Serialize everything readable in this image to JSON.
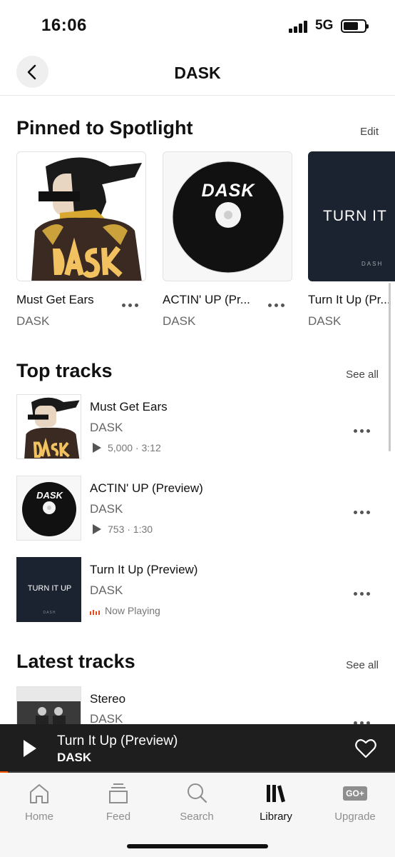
{
  "status": {
    "time": "16:06",
    "network": "5G"
  },
  "header": {
    "title": "DASK"
  },
  "pinned": {
    "title": "Pinned to Spotlight",
    "edit_label": "Edit",
    "cards": [
      {
        "title": "Must Get Ears",
        "artist": "DASK"
      },
      {
        "title": "ACTIN' UP (Pr...",
        "artist": "DASK"
      },
      {
        "title": "Turn It Up (Pr...",
        "artist": "DASK"
      }
    ],
    "art_text": {
      "logo": "DASK",
      "turn_it": "TURN IT",
      "turn_it_up": "TURN IT UP",
      "dash": "DASH"
    }
  },
  "top_tracks": {
    "title": "Top tracks",
    "see_all": "See all",
    "items": [
      {
        "title": "Must Get Ears",
        "artist": "DASK",
        "meta": "5,000 · 3:12"
      },
      {
        "title": "ACTIN' UP (Preview)",
        "artist": "DASK",
        "meta": "753 · 1:30"
      },
      {
        "title": "Turn It Up (Preview)",
        "artist": "DASK",
        "meta": "Now Playing"
      }
    ]
  },
  "latest_tracks": {
    "title": "Latest tracks",
    "see_all": "See all",
    "items": [
      {
        "title": "Stereo",
        "artist": "DASK"
      }
    ]
  },
  "player": {
    "title": "Turn It Up (Preview)",
    "artist": "DASK",
    "progress": 0.02
  },
  "tabs": [
    {
      "label": "Home",
      "icon": "home-icon"
    },
    {
      "label": "Feed",
      "icon": "feed-icon"
    },
    {
      "label": "Search",
      "icon": "search-icon"
    },
    {
      "label": "Library",
      "icon": "library-icon",
      "active": true
    },
    {
      "label": "Upgrade",
      "icon": "upgrade-icon",
      "badge": "GO+"
    }
  ],
  "colors": {
    "accent": "#ff5500",
    "now_playing": "#e24a1a",
    "player_bg": "#1e1e1f"
  }
}
